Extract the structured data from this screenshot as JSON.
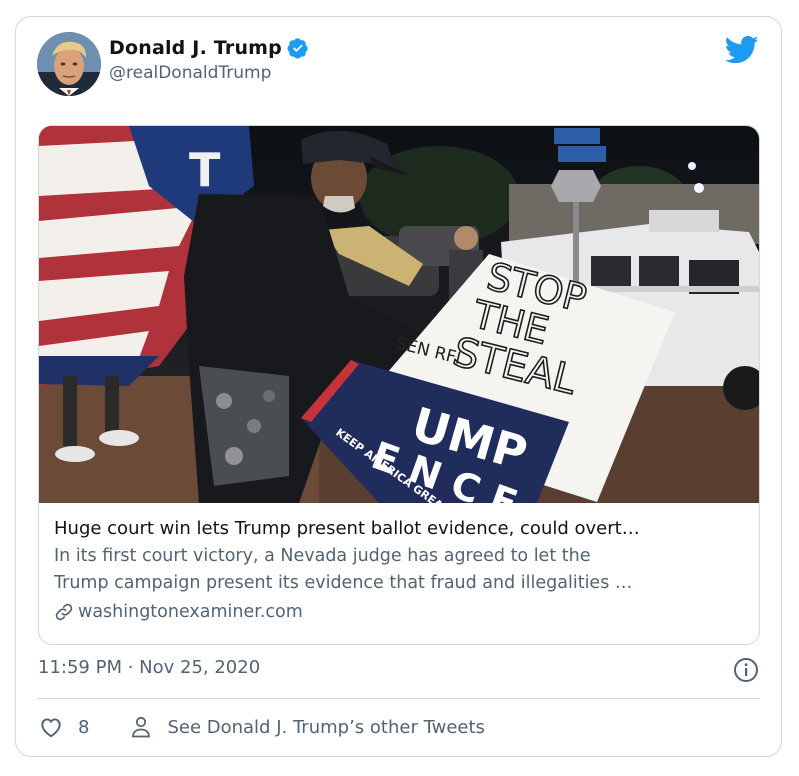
{
  "author": {
    "name": "Donald J. Trump",
    "handle": "@realDonaldTrump",
    "verified": true
  },
  "card": {
    "image_sign": {
      "line1": "STOP",
      "line2": "THE",
      "line3": "STEAL",
      "scribble": "SEN    RFI",
      "poster_main": "UMP",
      "poster_sub": "E N C E",
      "poster_slogan": "KEEP AMERICA GREA"
    },
    "title": "Huge court win lets Trump present ballot evidence, could overt…",
    "description_line1": "In its first court victory, a Nevada judge has agreed to let the",
    "description_line2": "Trump campaign present its evidence that fraud and illegalities …",
    "domain": "washingtonexaminer.com"
  },
  "timestamp": "11:59 PM · Nov 25, 2020",
  "actions": {
    "like_count": "8",
    "other_tweets_label": "See Donald J. Trump’s other Tweets"
  },
  "colors": {
    "brand_blue": "#1d9bf0",
    "text_primary": "#0f1419",
    "text_secondary": "#536471",
    "border": "#cfd9de"
  },
  "icons": [
    "verified-badge-icon",
    "twitter-bird-icon",
    "link-icon",
    "info-icon",
    "heart-icon",
    "person-icon"
  ]
}
